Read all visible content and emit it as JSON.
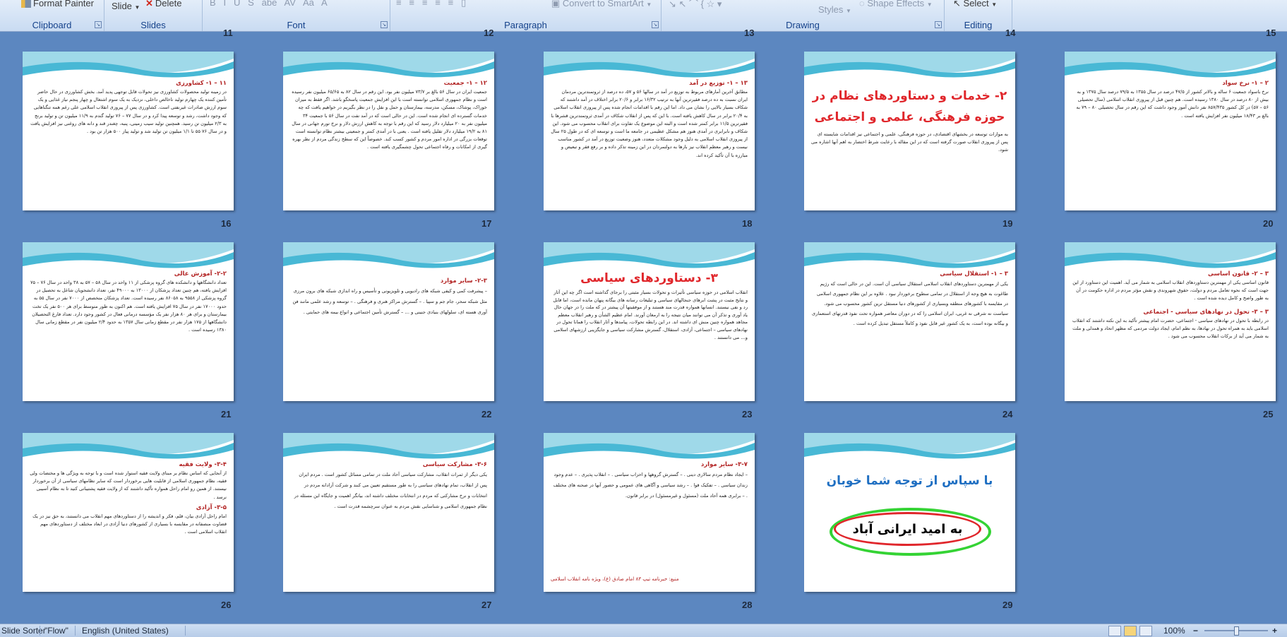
{
  "ribbon": {
    "format_painter": "Format Painter",
    "slide_btn": "Slide",
    "delete_btn": "Delete",
    "convert_smartart": "Convert to SmartArt",
    "styles": "Styles",
    "shape_effects": "Shape Effects",
    "select": "Select",
    "groups": {
      "clipboard": "Clipboard",
      "slides": "Slides",
      "font": "Font",
      "paragraph": "Paragraph",
      "drawing": "Drawing",
      "editing": "Editing"
    }
  },
  "top_row_numbers": [
    "11",
    "12",
    "13",
    "14",
    "15"
  ],
  "slides": [
    {
      "num": "16",
      "title": "۱۱ – ۱- کشاورزی",
      "text": "در زمینه تولید محصولات کشاورزی نیز تحولات قابل توجهی پدید آمد. بخش کشاورزی در حال حاضر تأمین کننده یک چهارم تولید ناخالص داخلی، نزدیک به یک سوم اشتغال و چهار پنجم نیاز غذایی و یک سوم ارزش صادرات غیرنفتی است. کشاورزی پس از پیروزی انقلاب اسلامی علی رغم همه تنگناهایی که وجود داشت، رشد و توسعه پیدا کرد و در سال ۷۷ – ۷۶ تولید گندم به ۱۱/۹ میلیون تن و تولید برنج به ۲/۳ میلیون تن رسید. همچنین تولید سیب زمینی، پنبه، چغندر قند و دانه های روغنی نیز افزایش یافت و در سال ۷۶ ۵۵ تا ۱/۱ میلیون تن تولید شد و تولید پیاز ۵۰۰ هزار تن بود ."
    },
    {
      "num": "17",
      "title": "۱۲ – ۱- جمعیت",
      "text": "جمعیت ایران در سال ۵۶ بالغ بر ۷۳/۷ میلیون نفر بود. این رقم در سال ۸۲ به ۶۵/۶۵ میلیون نفر رسیده است و نظام جمهوری اسلامی توانسته است با این افزایش جمعیت پاسخگو باشد. اگر فقط به میزان خوراک، پوشاک، مسکن، مدرسه، بیمارستان و حمل و نقل را در نظر بگیریم در خواهیم یافت که چه خدمات گسترده ای انجام شده است. این در حالی است که در آمد نفت در سال ۵۶ با جمعیت ۳۴ میلیون نفر به ۲۰ میلیارد دلار رسید که این رقم با توجه به کاهش ارزش دلار و نرخ تورم جهانی در سال ۸۱ به ۱۹/۲ میلیارد دلار تقلیل یافته است . یعنی با در آمدی کمتر و جمعیتی بیشتر نظام توانسته است توقعات بزرگی در اداره امور مردم و کشور کسب کند. خصوصاً این که سطح زندگی مردم از نظر بهره گیری از امکانات و رفاه اجتماعی تحول چشمگیری یافته است ."
    },
    {
      "num": "18",
      "title": "۱۳ – ۱- توزیع در آمد",
      "text": "مطابق آخرین آمارهای مربوط به توزیع در آمد در سالها ۵۶ و ۵۷، ده درصد از ثروتمندترین مردمان ایران نسبت به ده درصد فقیرترین آنها به ترتیب ۱۶/۳۲ برابر و ۲۰/۶ برابر اختلاف در آمد داشتند که شکاف بسیار بالایی را نشان می داد. اما این رقم با اقدامات انجام شده پس از پیروزی انقلاب اسلامی به ۲۰/۴ برابر در سال کاهش یافته است. با این که پس از انقلاب شکاف در آمدی ثروتمندترین قشرها با فقیرترین ۱۱/۵ برابر کمتر شده است و البته این موضوع یک تفاوت برای انقلاب محسوب می شود. این شکاف و نابرابری در آمدی هنوز هم مشکل عظیمی در جامعه ما است و توسعه ای که در طول ۲۵ سال از پیروزی انقلاب اسلامی به دلیل وجود مشکلات متعدد، هنوز وضعیت توزیع در آمد در کشور مناسب نیست و رهبر معظم انقلاب نیز بارها به دولتمردان در این زمینه تذکر داده و بر رفع فقر و تبعیض و مبارزه با آن تأکید کرده اند."
    },
    {
      "num": "19",
      "big": "۲- خدمات و دستاوردهای نظام در حوزه فرهنگی، علمی و اجتماعی",
      "text": "به موازات توسعه در بخشهای اقتصادی، در حوزه فرهنگی، علمی و اجتماعی نیز اقدامات شایسته ای پس از پیروزی انقلاب صورت گرفته است که در این مقاله با رعایت شرط اختصار به اهم آنها اشاره می شود."
    },
    {
      "num": "20",
      "title": "۲ – ۱- نرخ سواد",
      "text": "نرخ باسواد جمعیت ۶ ساله و بالاتر کشور از ۴۷/۵ درصد در سال ۱۳۵۵ به ۷۹/۵ درصد سال ۱۳۷۵ و به بیش از ۸۰ درصد در سال ۱۳۸۰ رسیده است. هم چنین قبل از پیروزی انقلاب اسلامی (سال تحصیلی ۵۶ – ۵۷) در کل کشور ۸۵۷/۴۳۵ نفر دانش آموز وجود داشت که این رقم در سال تحصیلی ۸۰ – ۷۹ به بالغ بر ۱۸/۴۳ میلیون نفر افزایش یافته است ."
    },
    {
      "num": "21",
      "title": "۲-۲- آموزش عالی",
      "text": "تعداد دانشگاهها و دانشکده های گروه پزشکی از ۱۱ واحد در سال ۵۸ – ۵۷ به ۳۸ واحد در سال ۷۶ – ۷۵ افزایش یافته، هم چنین تعداد پزشکان از ۱۳۰۰۰ به ۴۹۰۰۰ نفر، تعداد دانشجویان شاغل به تحصیل در گروه پزشکی از ۹۵۵۸ به ۸۶۰۵۸ نفر رسیده است. تعداد پزشکان متخصص از ۷۰۰۰ نفر در سال ۵۵ به حدود ۱۷۰۰۰ نفر در سال ۷۵ افزایش یافته است. هم اکنون به طور متوسط برای هر ۵۰۰ نفر یک تخت بیمارستان و برای هر ۸۰ هزار نفر یک مؤسسه درمانی فعال در کشور وجود دارد. تعداد فارغ التحصیلان دانشگاهها از ۱۷۵ هزار نفر در مقطع زمانی سال ۱۳۵۷ به حدود ۲/۴ میلیون نفر در مقطع زمانی سال ۱۳۸۰ رسیده است ."
    },
    {
      "num": "22",
      "title": "۲-۳- سایر موارد",
      "text": "– پیشرفت کمی و کیفی شبکه های رادیویی و تلویزیونی و تأسیس و راه اندازی شبکه های برون مرزی مثل شبکه سحر، جام جم و سپیا . – گسترش مراکز هنری و فرهنگی . – توسعه و رشد علمی مانند فن آوری هسته ای، سلولهای بنیادی جنینی و … – گسترش تأمین اجتماعی و انواع بیمه های حمایتی ."
    },
    {
      "num": "23",
      "big": "۳- دستاوردهای سیاسی",
      "text": "انقلاب اسلامی در حوزه سیاسی تأثیرات و تحولات بسیار مثبتی را برجای گذاشته است اگر چه این آثار و نتایج مثبت در پشت ابرهای جنجالهای سیاسی و تبلیغات رسانه های بیگانه پنهان مانده است، اما قابل رد و نفی نیستند. انسانها همواره قدرت مند هستند و از موفقیتها آن پیشتر در که ملت را در جهان حال یاد آوری و تذکر آن می توانند میان نتیجه را به ارمغان آورند. امام عظیم الشأن و رهبر انقلاب معظم مجاهد همواره چنین منش ای داشته اند. در این رابطه تحولات، پیامدها و آثار انقلاب را همانا تحول در نهادهای سیاسی – اجتماعی، آزادی، استقلال، گسترش مشارکت سیاسی و جایگزینی ارزشهای اسلامی و… می دانستند ."
    },
    {
      "num": "24",
      "title": "۳ – ۱- استقلال سیاسی",
      "text": "یکی از مهمترین دستاوردهای انقلاب اسلامی استقلال سیاسی آن است. این در حالی است که رژیم طاغوت به هیچ وجه از استقلال در تمامی سطوح برخوردار نبود . علاوه بر این نظام جمهوری اسلامی در مقایسه با کشورهای منطقه وبسیاری از کشورهای دنیا مستقل ترین کشور محسوب می شود. سیاست نه شرقی نه غربی، ایران اسلامی را که در دوران معاصر همواره تحت نفوذ قدرتهای استعماری و بیگانه بوده است، به یک کشور غیر قابل نفوذ و کاملاً مستقل تبدیل کرده است ."
    },
    {
      "num": "25",
      "title": "۳ – ۲- قانون اساسی",
      "text": "قانون اساسی یکی از مهمترین دستاوردهای انقلاب اسلامی به شمار می آید. اهمیت این دستاورد از این جهت است که نحوه تعامل مردم و دولت، حقوق شهروندی و نقش مؤثر مردم در اداره حکومت در آن به طور واضح و کامل دیده شده است .",
      "title2": "۳ – ۳- تحول در نهادهای سیاسی - اجتماعی",
      "text2": "در رابطه با تحول در نهادهای سیاسی - اجتماعی، حضرت امام پیشتر تأکید به این نکته داشتند که انقلاب اسلامی باید به همراه تحول در نهادها، به نظم امام، ایجاد دولت مردمی که مظهر اتحاد و همدلی و ملت به شمار می آید از برکات انقلاب محسوب می شود ."
    },
    {
      "num": "26",
      "title": "۳-۴- ولایت فقیه",
      "text": "از آنجایی که اساس نظام بر مبنای ولایت فقیه استوار شده است و با توجه به ویژگی ها و مختصات ولی فقیه، نظام جمهوری اسلامی از قابلیت هایی برخوردار است که سایر نظامهای سیاسی از آن برخوردار نیستند. از همین رو امام راحل همواره تأکید داشتند که از ولایت فقیه پشتیبانی کنید تا به نظام آسیبی نرسد .",
      "title2": "۳-۵- آزادی",
      "text2": "امام راحل آزادی بیان، قلم، فکر و اندیشه را از دستاوردهای مهم انقلاب می دانستند، به حق نیز در یک قضاوت منصفانه در مقایسه با بسیاری از کشورهای دنیا آزادی در ابعاد مختلف از دستاوردهای مهم انقلاب اسلامی است ."
    },
    {
      "num": "27",
      "title": "۳-۶- مشارکت سیاسی",
      "text": "یکی دیگر از ثمرات انقلاب، مشارکت سیاسی آحاد ملت در تمامی مسائل کشور است . مردم ایران پس از انقلاب، تمام نهادهای سیاسی را به طور مستقیم تعیین می کنند و شرکت آزادانه مردم در انتخابات و نرخ مشارکتی که مردم در انتخابات مختلف داشته اند، بیانگر اهمیت و جایگاه این مسئله در نظام جمهوری اسلامی و شناسایی نقش مردم به عنوان سرچشمه قدرت است ."
    },
    {
      "num": "28",
      "title": "۳-۷- سایر موارد",
      "text": "– ایجاد نظام مردم سالاری دینی . – گسترش گروهها و احزاب سیاسی . – انقلاب پذیری . – عدم وجود زندان سیاسی . – تفکیک قوا . – رشد سیاسی و آگاهی های عمومی و حضور آنها در صحنه های مختلف . – برابری همه آحاد ملت (مسئول و غیرمسئول) در برابر قانون.",
      "source": "منبع: خبرنامه تیپ ۸۳ امام صادق (ع)، ویژه نامه انقلاب اسلامی"
    },
    {
      "num": "29",
      "thanks": "با سپاس از توجه شما خوبان",
      "ring": "به امید ایرانی آباد"
    }
  ],
  "status": {
    "view": "Slide Sorter",
    "theme": "\"Flow\"",
    "language": "English (United States)",
    "zoom": "100%"
  },
  "colors": {
    "background": "#5c87c0",
    "title_red": "#e0262b",
    "heading_red": "#b22222",
    "thanks_blue": "#1f6fc2",
    "ring_green": "#34d334"
  }
}
